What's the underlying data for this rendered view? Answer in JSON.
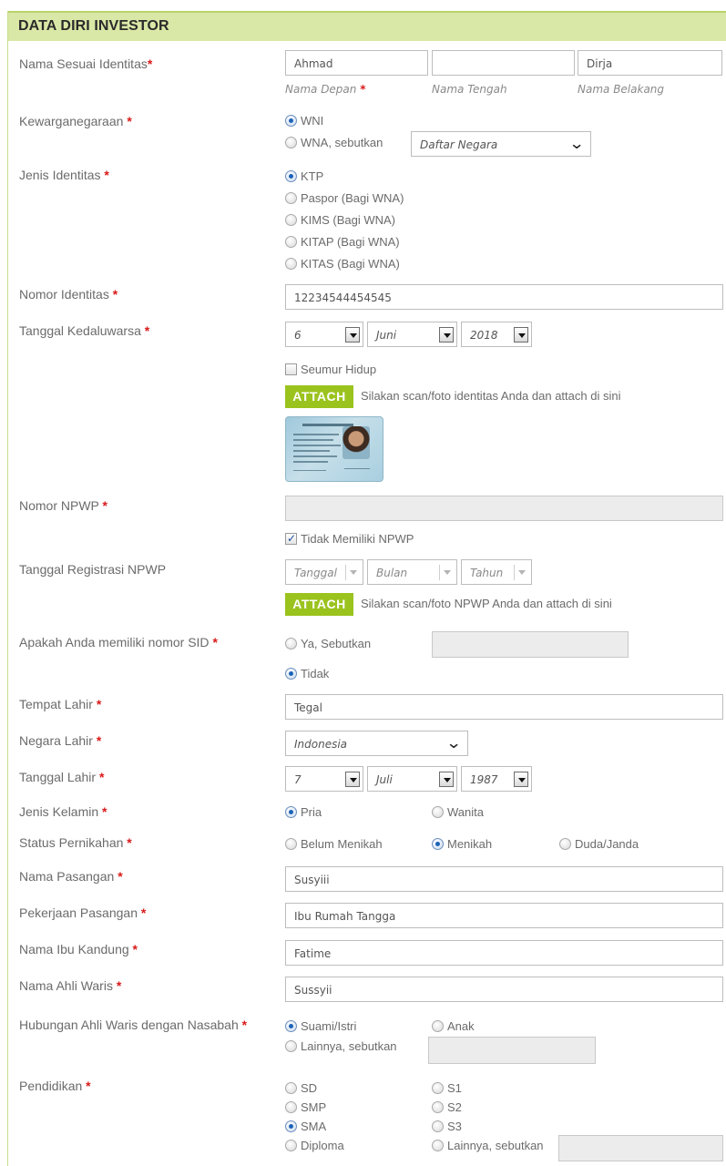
{
  "header": {
    "title": "DATA DIRI INVESTOR"
  },
  "required_mark": "*",
  "colors": {
    "accent_green": "#9bc31e",
    "header_bg": "#d9e8a6",
    "required_red": "#d91a1a",
    "radio_blue": "#1c63b7"
  },
  "nama": {
    "label": "Nama Sesuai Identitas",
    "depan": "Ahmad",
    "tengah": "",
    "belakang": "Dirja",
    "hint_depan": "Nama Depan",
    "hint_tengah": "Nama Tengah",
    "hint_belakang": "Nama Belakang"
  },
  "kewarganegaraan": {
    "label": "Kewarganegaraan ",
    "opt_wni": "WNI",
    "opt_wna": "WNA, sebutkan",
    "negara_select": "Daftar Negara",
    "selected": "WNI"
  },
  "jenis_identitas": {
    "label": "Jenis Identitas ",
    "options": [
      "KTP",
      "Paspor (Bagi WNA)",
      "KIMS (Bagi WNA)",
      "KITAP (Bagi WNA)",
      "KITAS (Bagi WNA)"
    ],
    "selected": "KTP"
  },
  "nomor_identitas": {
    "label": "Nomor Identitas ",
    "value": "12234544454545"
  },
  "kedaluwarsa": {
    "label": "Tanggal Kedaluwarsa ",
    "tanggal": "6",
    "bulan": "Juni",
    "tahun": "2018",
    "seumur_hidup": "Seumur Hidup",
    "seumur_hidup_checked": false,
    "attach_label": "ATTACH",
    "attach_note": "Silakan scan/foto identitas Anda dan attach di sini",
    "attachment_icon": "id-card-thumbnail"
  },
  "npwp": {
    "label": "Nomor NPWP ",
    "value": "",
    "tidak_memiliki": "Tidak Memiliki NPWP",
    "tidak_memiliki_checked": true
  },
  "registrasi_npwp": {
    "label": "Tanggal Registrasi NPWP",
    "tanggal": "Tanggal",
    "bulan": "Bulan",
    "tahun": "Tahun",
    "attach_label": "ATTACH",
    "attach_note": "Silakan scan/foto NPWP Anda dan attach di sini"
  },
  "sid": {
    "label": "Apakah Anda memiliki nomor SID ",
    "opt_ya": "Ya, Sebutkan",
    "opt_tidak": "Tidak",
    "selected": "Tidak",
    "value": ""
  },
  "tempat_lahir": {
    "label": "Tempat Lahir ",
    "value": "Tegal"
  },
  "negara_lahir": {
    "label": "Negara Lahir ",
    "value": "Indonesia"
  },
  "tanggal_lahir": {
    "label": "Tanggal Lahir ",
    "tanggal": "7",
    "bulan": "Juli",
    "tahun": "1987"
  },
  "jenis_kelamin": {
    "label": "Jenis Kelamin ",
    "opt_pria": "Pria",
    "opt_wanita": "Wanita",
    "selected": "Pria"
  },
  "status_pernikahan": {
    "label": "Status Pernikahan ",
    "opt_belum": "Belum Menikah",
    "opt_menikah": "Menikah",
    "opt_duda": "Duda/Janda",
    "selected": "Menikah"
  },
  "nama_pasangan": {
    "label": "Nama Pasangan ",
    "value": "Susyiii"
  },
  "pekerjaan_pasangan": {
    "label": "Pekerjaan Pasangan ",
    "value": "Ibu Rumah Tangga"
  },
  "ibu_kandung": {
    "label": "Nama Ibu Kandung ",
    "value": "Fatime"
  },
  "ahli_waris": {
    "label": "Nama Ahli Waris ",
    "value": "Sussyii"
  },
  "hubungan_ahli_waris": {
    "label": "Hubungan Ahli Waris dengan Nasabah ",
    "opt_suami": "Suami/Istri",
    "opt_anak": "Anak",
    "opt_lainnya": "Lainnya, sebutkan",
    "selected": "Suami/Istri",
    "value": ""
  },
  "pendidikan": {
    "label": "Pendidikan ",
    "col1": [
      "SD",
      "SMP",
      "SMA",
      "Diploma"
    ],
    "col2": [
      "S1",
      "S2",
      "S3",
      "Lainnya, sebutkan"
    ],
    "selected": "SMA",
    "value": ""
  }
}
